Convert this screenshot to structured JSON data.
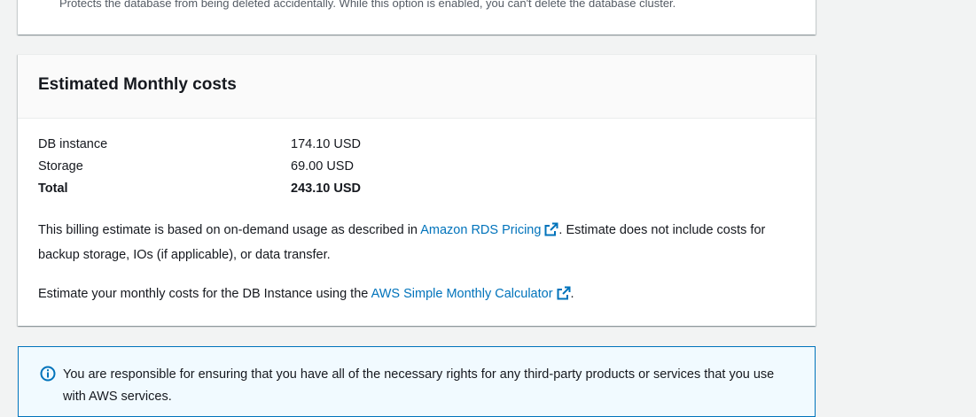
{
  "deletion_protection": {
    "description": "Protects the database from being deleted accidentally. While this option is enabled, you can't delete the database cluster."
  },
  "costs": {
    "title": "Estimated Monthly costs",
    "rows": [
      {
        "label": "DB instance",
        "value": "174.10 USD"
      },
      {
        "label": "Storage",
        "value": "69.00 USD"
      },
      {
        "label": "Total",
        "value": "243.10 USD"
      }
    ],
    "billing_note": {
      "prefix": "This billing estimate is based on on-demand usage as described in ",
      "link": "Amazon RDS Pricing",
      "suffix": ". Estimate does not include costs for backup storage, IOs (if applicable), or data transfer."
    },
    "calculator_note": {
      "prefix": "Estimate your monthly costs for the DB Instance using the ",
      "link": "AWS Simple Monthly Calculator",
      "suffix": "."
    }
  },
  "info": {
    "text": "You are responsible for ensuring that you have all of the necessary rights for any third-party products or services that you use with AWS services."
  },
  "colors": {
    "link": "#0073bb",
    "info_border": "#0073bb",
    "info_bg": "#f1faff"
  }
}
